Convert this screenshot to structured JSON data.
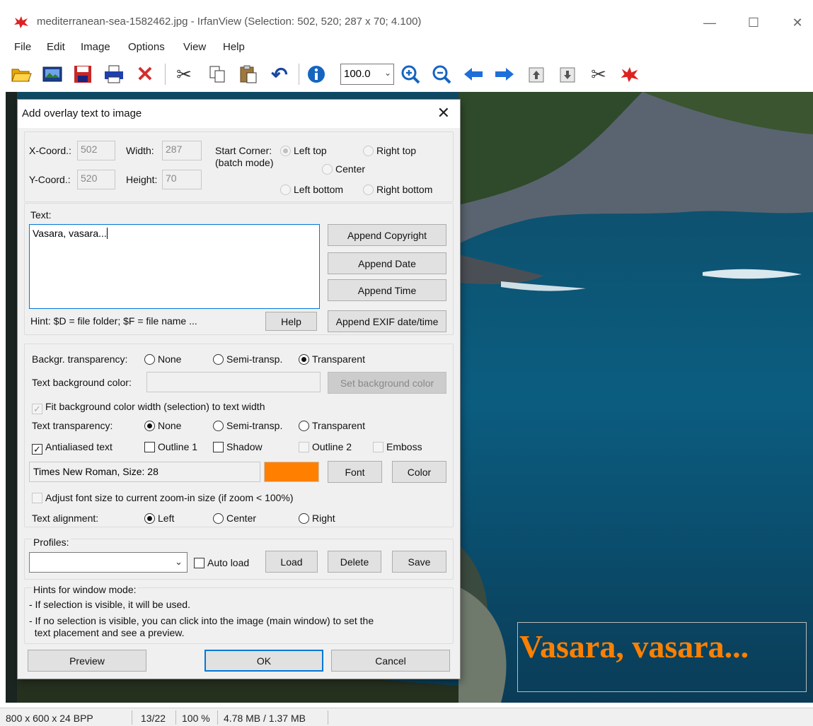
{
  "window": {
    "title": "mediterranean-sea-1582462.jpg - IrfanView (Selection: 502, 520; 287 x 70; 4.100)",
    "minimize": "—",
    "maximize": "☐",
    "close": "✕"
  },
  "menu": [
    "File",
    "Edit",
    "Image",
    "Options",
    "View",
    "Help"
  ],
  "toolbar": {
    "zoom_value": "100.0",
    "icons": [
      "open-folder",
      "thumbnails",
      "save",
      "print",
      "delete",
      "cut",
      "copy",
      "paste",
      "undo",
      "info",
      "zoom-in",
      "zoom-out",
      "previous",
      "next",
      "first-page",
      "last-page",
      "settings",
      "irfanview-logo"
    ]
  },
  "status": {
    "dimensions": "800 x 600 x 24 BPP",
    "index": "13/22",
    "zoom": "100 %",
    "size": "4.78 MB / 1.37 MB"
  },
  "image_overlay_text": "Vasara, vasara...",
  "dialog": {
    "title": "Add overlay text to image",
    "close": "✕",
    "coords": {
      "x_label": "X-Coord.:",
      "x_value": "502",
      "y_label": "Y-Coord.:",
      "y_value": "520",
      "w_label": "Width:",
      "w_value": "287",
      "h_label": "Height:",
      "h_value": "70"
    },
    "start_corner": {
      "label": "Start Corner:",
      "sublabel": "(batch mode)",
      "options": [
        "Left top",
        "Right top",
        "Center",
        "Left bottom",
        "Right bottom"
      ],
      "selected": "Left top"
    },
    "text": {
      "label": "Text:",
      "value": "Vasara, vasara...",
      "hint": "Hint: $D = file folder; $F = file name ...",
      "help_button": "Help",
      "buttons": [
        "Append Copyright",
        "Append Date",
        "Append Time",
        "Append EXIF date/time"
      ]
    },
    "background": {
      "transparency_label": "Backgr. transparency:",
      "transparency_options": [
        "None",
        "Semi-transp.",
        "Transparent"
      ],
      "transparency_selected": "Transparent",
      "color_label": "Text background color:",
      "color_button": "Set background color",
      "fit_label": "Fit background color width (selection) to text width"
    },
    "text_transparency": {
      "label": "Text transparency:",
      "options": [
        "None",
        "Semi-transp.",
        "Transparent"
      ],
      "selected": "None"
    },
    "effects": {
      "antialiased": "Antialiased text",
      "outline1": "Outline 1",
      "shadow": "Shadow",
      "outline2": "Outline 2",
      "emboss": "Emboss",
      "antialiased_checked": true
    },
    "font": {
      "description": "Times New Roman, Size: 28",
      "color": "#ff8000",
      "font_button": "Font",
      "color_button": "Color",
      "adjust_label": "Adjust font size to current zoom-in size (if zoom < 100%)"
    },
    "alignment": {
      "label": "Text alignment:",
      "options": [
        "Left",
        "Center",
        "Right"
      ],
      "selected": "Left"
    },
    "profiles": {
      "label": "Profiles:",
      "auto_load": "Auto load",
      "load": "Load",
      "delete": "Delete",
      "save": "Save"
    },
    "hints": {
      "title": "Hints for window mode:",
      "line1": "- If selection is visible, it will be used.",
      "line2": "- If no selection is visible, you can click into the image (main window) to set the",
      "line3": "  text placement and see a preview."
    },
    "buttons": {
      "preview": "Preview",
      "ok": "OK",
      "cancel": "Cancel"
    }
  }
}
